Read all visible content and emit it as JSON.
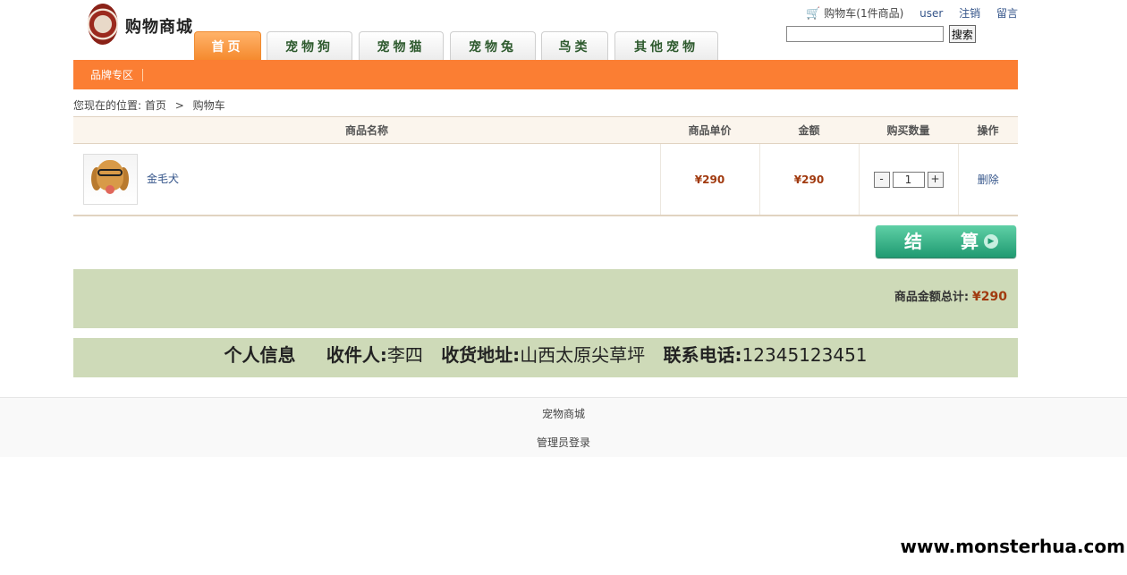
{
  "header": {
    "logo_text": "购物商城",
    "cart_label": "购物车(1件商品)",
    "user": "user",
    "logout": "注销",
    "message": "留言",
    "search_value": "",
    "search_button": "搜索"
  },
  "tabs": [
    "首页",
    "宠物狗",
    "宠物猫",
    "宠物兔",
    "鸟类",
    "其他宠物"
  ],
  "orange_bar": {
    "brand": "品牌专区"
  },
  "breadcrumb": {
    "prefix": "您现在的位置:",
    "home": "首页",
    "sep": ">",
    "current": "购物车"
  },
  "table": {
    "headers": [
      "商品名称",
      "商品单价",
      "金额",
      "购买数量",
      "操作"
    ],
    "rows": [
      {
        "name": "金毛犬",
        "unit_price": "¥290",
        "amount": "¥290",
        "minus": "-",
        "qty": "1",
        "plus": "+",
        "action": "删除"
      }
    ]
  },
  "checkout_label": "结 算",
  "total": {
    "label": "商品金额总计:",
    "value": "¥290"
  },
  "info": {
    "title": "个人信息",
    "receiver_label": "收件人:",
    "receiver": "李四",
    "address_label": "收货地址:",
    "address": "山西太原尖草坪",
    "phone_label": "联系电话:",
    "phone": "12345123451"
  },
  "footer": {
    "site": "宠物商城",
    "admin_login": "管理员登录"
  },
  "watermark": "www.monsterhua.com",
  "colors": {
    "orange": "#fb7e33",
    "green_panel": "#cedab8",
    "price": "#a13a0f",
    "checkout": "#1f9a71"
  }
}
